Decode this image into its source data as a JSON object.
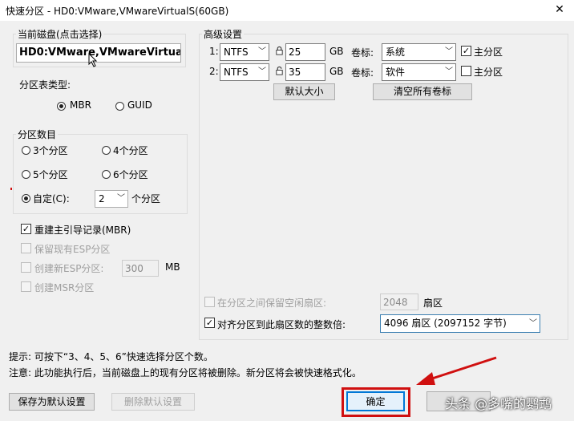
{
  "window": {
    "title": "快速分区 - HD0:VMware,VMwareVirtualS(60GB)",
    "close_glyph": "✕"
  },
  "disk": {
    "group_label": "当前磁盘(点击选择)",
    "value": "HD0:VMware,VMwareVirtualS("
  },
  "table_type": {
    "label": "分区表类型:",
    "options": [
      "MBR",
      "GUID"
    ],
    "selected": "MBR"
  },
  "partition_count": {
    "group_label": "分区数目",
    "options": [
      "3个分区",
      "4个分区",
      "5个分区",
      "6个分区"
    ],
    "custom_label": "自定(C):",
    "custom_value": "2",
    "custom_unit": "个分区"
  },
  "options": {
    "rebuild_mbr": "重建主引导记录(MBR)",
    "keep_esp": "保留现有ESP分区",
    "create_esp": "创建新ESP分区:",
    "esp_size": "300",
    "esp_unit": "MB",
    "create_msr": "创建MSR分区"
  },
  "advanced": {
    "group_label": "高级设置",
    "rows": [
      {
        "index": "1:",
        "fs": "NTFS",
        "size": "25",
        "unit": "GB",
        "label_text": "卷标:",
        "volume": "系统",
        "primary_label": "主分区",
        "primary": true
      },
      {
        "index": "2:",
        "fs": "NTFS",
        "size": "35",
        "unit": "GB",
        "label_text": "卷标:",
        "volume": "软件",
        "primary_label": "主分区",
        "primary": false
      }
    ],
    "default_size_button": "默认大小",
    "clear_labels_button": "清空所有卷标",
    "keep_free_label": "在分区之间保留空闲扇区:",
    "keep_free_value": "2048",
    "sector_unit": "扇区",
    "align_label": "对齐分区到此扇区数的整数倍:",
    "align_value": "4096 扇区 (2097152 字节)"
  },
  "tips": {
    "line1": "提示: 可按下“3、4、5、6”快速选择分区个数。",
    "line2": "注意: 此功能执行后，当前磁盘上的现有分区将被删除。新分区将会被快速格式化。"
  },
  "footer": {
    "save_default": "保存为默认设置",
    "delete_default": "删除默认设置",
    "ok": "确定"
  },
  "watermark": "头条 @多嘴的鹦鹉",
  "colors": {
    "highlight_red": "#d01010",
    "dialog_bg": "#f0f0f0"
  }
}
